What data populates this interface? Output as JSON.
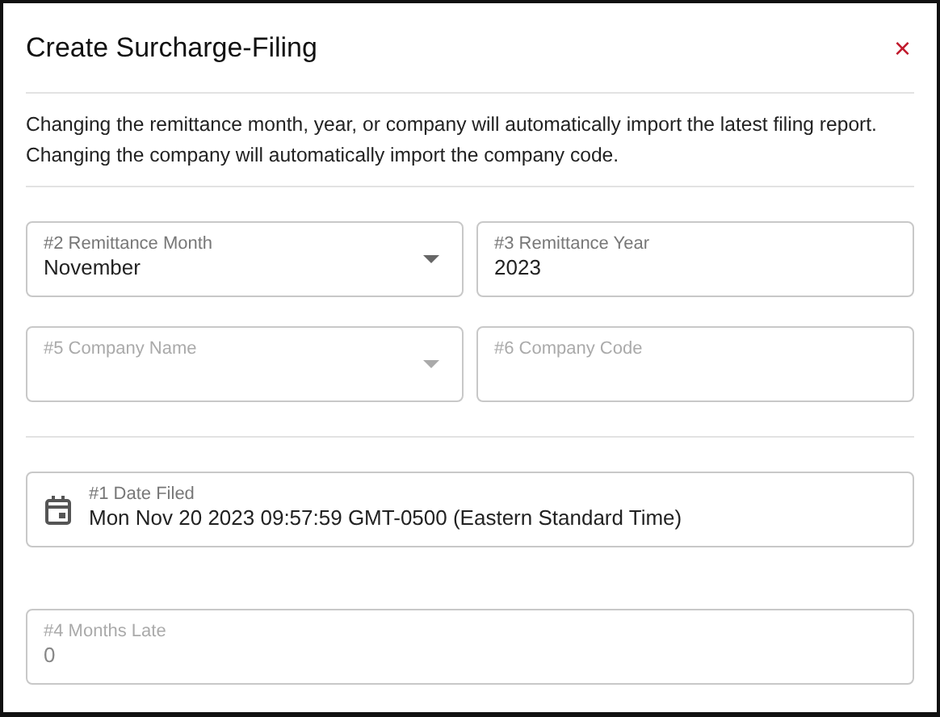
{
  "dialog": {
    "title": "Create Surcharge-Filing",
    "close_icon": "×",
    "info": [
      "Changing the remittance month, year, or company will automatically import the latest filing report.",
      "Changing the company will automatically import the company code."
    ],
    "sections": [
      {
        "rows": [
          [
            {
              "kind": "select",
              "label": "#2 Remittance Month",
              "value": "November",
              "disabled": false
            },
            {
              "kind": "text",
              "label": "#3 Remittance Year",
              "value": "2023",
              "disabled": false
            }
          ],
          [
            {
              "kind": "select",
              "label": "#5 Company Name",
              "disabled": true
            },
            {
              "kind": "text",
              "label": "#6 Company Code",
              "disabled": true
            }
          ]
        ]
      },
      {
        "rows": [
          [
            {
              "kind": "date",
              "label": "#1 Date Filed",
              "value": "Mon Nov 20 2023 09:57:59 GMT-0500 (Eastern Standard Time)",
              "disabled": false
            }
          ],
          [
            {
              "kind": "text",
              "label": "#4 Months Late",
              "value": "0",
              "disabled": true
            }
          ]
        ]
      }
    ]
  }
}
